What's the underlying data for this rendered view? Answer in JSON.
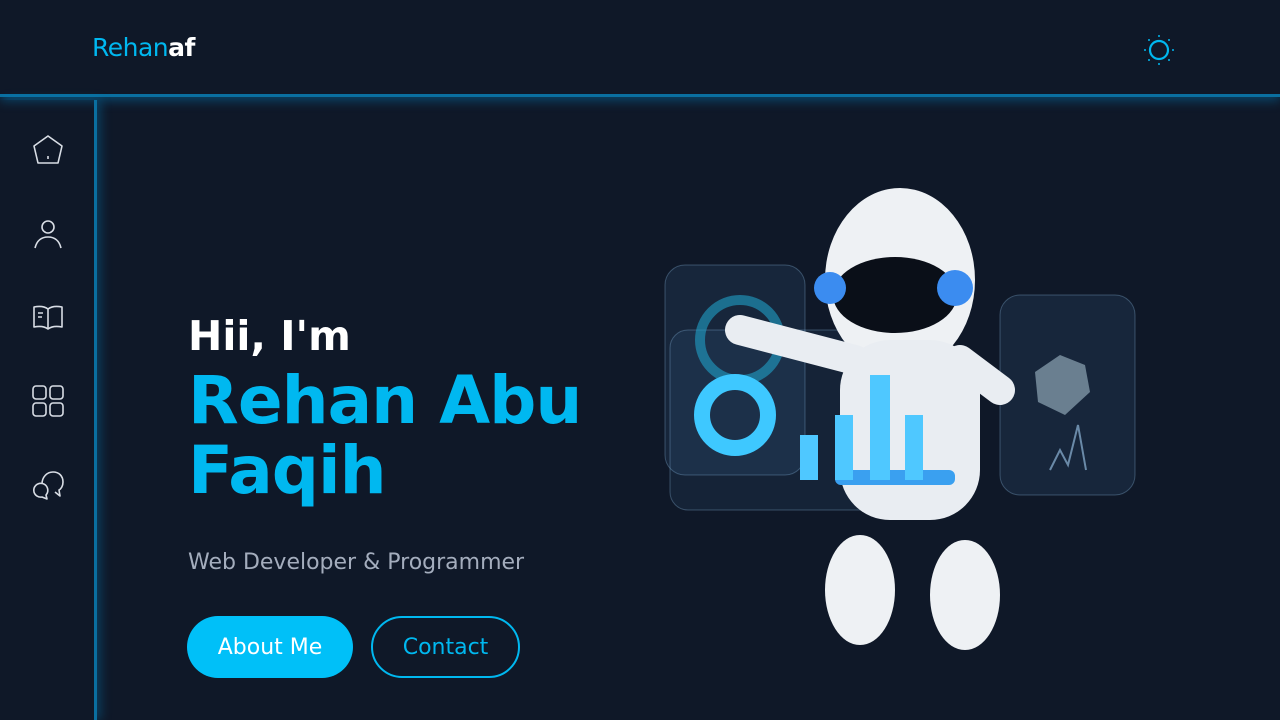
{
  "header": {
    "logo_part1": "Rehan",
    "logo_part2": "af",
    "theme_icon": "sun-icon"
  },
  "sidebar": {
    "items": [
      {
        "icon": "home-icon"
      },
      {
        "icon": "user-icon"
      },
      {
        "icon": "book-icon"
      },
      {
        "icon": "grid-icon"
      },
      {
        "icon": "chat-icon"
      }
    ]
  },
  "hero": {
    "greeting": "Hii, I'm",
    "name": "Rehan Abu Faqih",
    "role": "Web Developer & Programmer",
    "about_label": "About Me",
    "contact_label": "Contact"
  },
  "colors": {
    "accent": "#00b8f0",
    "background": "#0f1828",
    "border": "#0a6fa0"
  }
}
